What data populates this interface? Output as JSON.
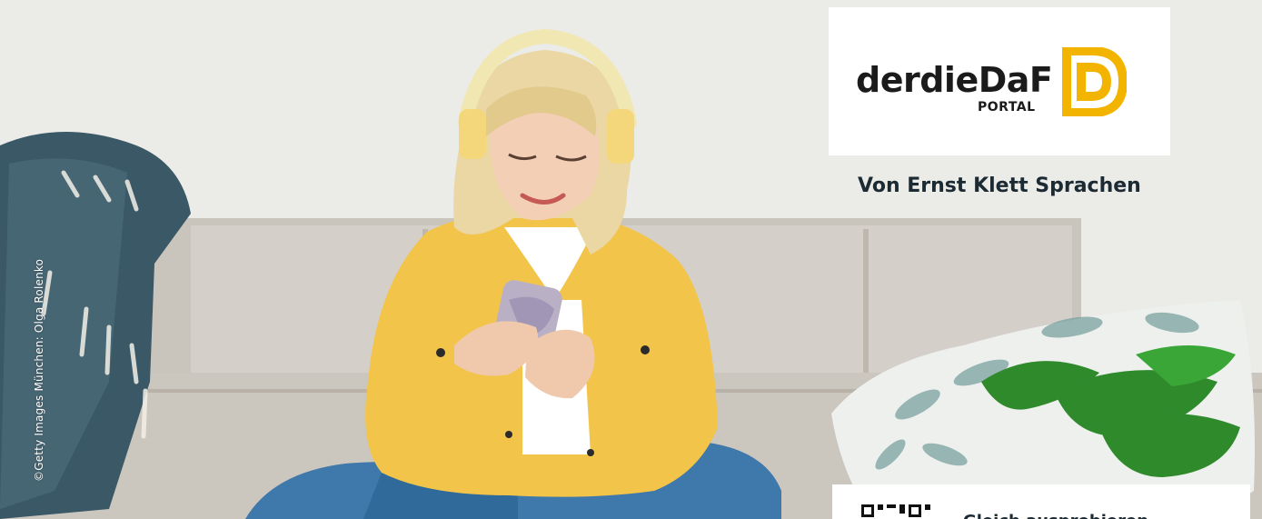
{
  "image": {
    "alt": "Junge Frau mit Kopfhörern sitzt auf einem Sofa und schaut lächelnd auf ihr Smartphone"
  },
  "credit": {
    "text": "©Getty Images München: Olga Rolenko"
  },
  "logo": {
    "wordmark": "derdieDaF",
    "subline": "PORTAL"
  },
  "publisher": {
    "text": "Von Ernst Klett Sprachen"
  },
  "qr_card": {
    "text": "Gleich ausprobieren"
  },
  "colors": {
    "accent": "#f3b400",
    "text_dark": "#1c2a33"
  }
}
